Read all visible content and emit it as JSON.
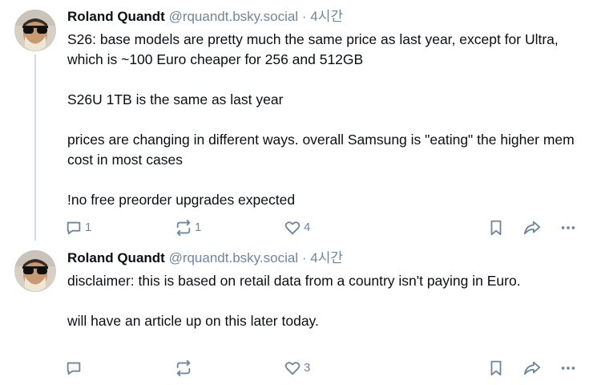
{
  "posts": [
    {
      "author": "Roland Quandt",
      "handle": "@rquandt.bsky.social",
      "separator": "·",
      "time": "4시간",
      "paragraphs": [
        "S26: base models are pretty much the same price as last year, except for Ultra, which is ~100 Euro cheaper for 256 and 512GB",
        "S26U 1TB is the same as last year",
        "prices are changing in different ways. overall Samsung is \"eating\" the higher mem cost in most cases",
        "!no free preorder upgrades expected"
      ],
      "reply_count": "1",
      "repost_count": "1",
      "like_count": "4"
    },
    {
      "author": "Roland Quandt",
      "handle": "@rquandt.bsky.social",
      "separator": "·",
      "time": "4시간",
      "paragraphs": [
        "disclaimer: this is based on retail data from a country isn't paying in Euro.",
        "will have an article up on this later today."
      ],
      "reply_count": "",
      "repost_count": "",
      "like_count": "3"
    }
  ],
  "icons": {
    "reply": "reply-icon",
    "repost": "repost-icon",
    "like": "heart-icon",
    "bookmark": "bookmark-icon",
    "share": "share-icon",
    "more": "more-icon"
  },
  "colors": {
    "muted": "#6f869f",
    "text": "#0b0f14",
    "thread_line": "#d4dbe2"
  }
}
